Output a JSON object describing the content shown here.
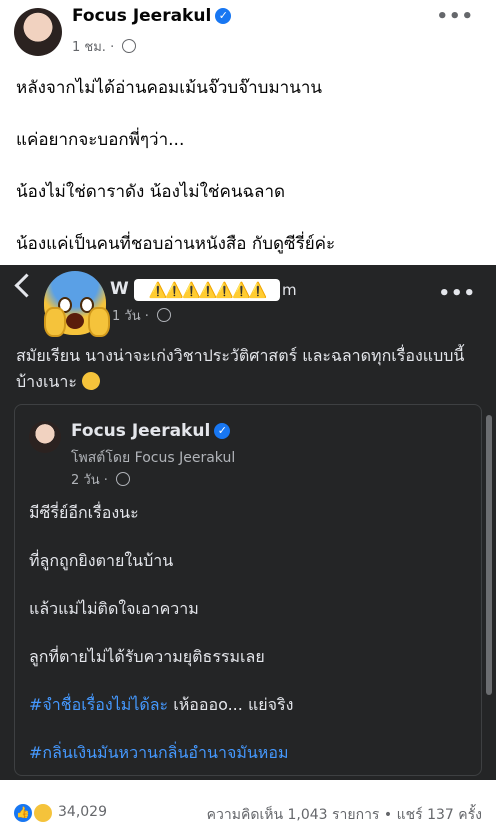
{
  "post": {
    "author": "Focus Jeerakul",
    "time": "1 ชม.",
    "paragraphs": [
      "หลังจากไม่ได้อ่านคอมเม้นจ๊วบจ๊าบมานาน",
      "แค่อยากจะบอกพี่ๆว่า...",
      "น้องไม่ใช่ดาราดัง น้องไม่ใช่คนฉลาด",
      "น้องแค่เป็นคนที่ชอบอ่านหนังสือ กับดูซีรี่ย์ค่ะ"
    ]
  },
  "shared": {
    "name_prefix": "W",
    "warnings": "⚠️⚠️⚠️⚠️⚠️⚠️⚠️",
    "name_suffix": "m",
    "time": "1 วัน",
    "text": "สมัยเรียน นางน่าจะเก่งวิชาประวัติศาสตร์ และฉลาดทุกเรื่องแบบนี้บ้างเนาะ",
    "inner": {
      "author": "Focus Jeerakul",
      "posted_by": "โพสต์โดย Focus Jeerakul",
      "time": "2 วัน",
      "lines": [
        "มีซีรี่ย์อีกเรื่องนะ",
        "ที่ลูกถูกยิงตายในบ้าน",
        "แล้วแม่ไม่ติดใจเอาความ",
        "ลูกที่ตายไม่ได้รับความยุติธรรมเลย"
      ],
      "hashtag1": "#จำชื่อเรื่องไม่ได้ละ",
      "after_hashtag1": " เห้อออo... แย่จริง",
      "hashtag2": "#กลิ่นเงินมันหวานกลิ่นอำนาจมันหอม"
    }
  },
  "footer": {
    "reactions": "34,029",
    "stats": "ความคิดเห็น 1,043 รายการ • แชร์ 137 ครั้ง"
  },
  "colors": {
    "verified": "#1877f2",
    "hashtag": "#4599ff",
    "dark_bg": "#242526"
  }
}
